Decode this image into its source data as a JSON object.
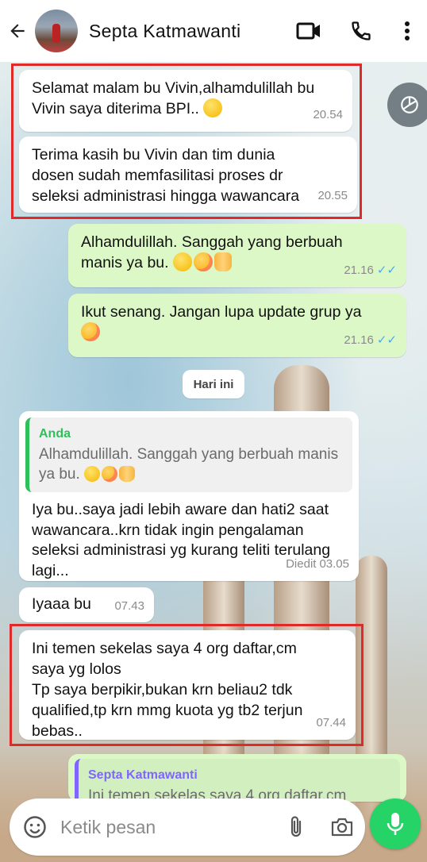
{
  "header": {
    "contact_name": "Septa Katmawanti",
    "icons": [
      "back-arrow-icon",
      "video-call-icon",
      "phone-icon",
      "more-vert-icon"
    ]
  },
  "messages": {
    "m1": {
      "text": "Selamat malam bu Vivin,alhamdulillah bu Vivin saya diterima BPI..",
      "emoji": "pleading-face",
      "time": "20.54"
    },
    "m2": {
      "text": "Terima kasih bu Vivin dan tim dunia dosen sudah memfasilitasi proses dr seleksi administrasi hingga wawancara",
      "time": "20.55"
    },
    "m3": {
      "text": "Alhamdulillah. Sanggah yang berbuah manis ya bu.",
      "emoji": [
        "star-struck",
        "smiling-hearts",
        "folded-hands"
      ],
      "time": "21.16",
      "ticks": "✓✓"
    },
    "m4": {
      "text": "Ikut senang. Jangan lupa update grup ya",
      "emoji": "smiling-hearts",
      "time": "21.16",
      "ticks": "✓✓"
    },
    "date_divider": "Hari ini",
    "m5": {
      "quote_author": "Anda",
      "quote_text": "Alhamdulillah. Sanggah yang berbuah manis ya bu.",
      "text": "Iya bu..saya jadi lebih aware dan hati2 saat wawancara..krn tidak ingin pengalaman seleksi administrasi yg kurang teliti terulang lagi...",
      "edited_label": "Diedit",
      "time": "03.05"
    },
    "m6": {
      "text": "Iyaaa bu",
      "time": "07.43"
    },
    "m7": {
      "text": "Ini temen sekelas saya 4 org daftar,cm saya yg lolos\nTp saya berpikir,bukan krn beliau2 tdk qualified,tp krn mmg kuota yg tb2 terjun bebas..",
      "time": "07.44"
    },
    "m8": {
      "quote_author": "Septa Katmawanti",
      "quote_text": "Ini temen sekelas saya 4 org daftar,cm"
    }
  },
  "composer": {
    "placeholder": "Ketik pesan",
    "icons": [
      "emoji-icon",
      "attach-icon",
      "camera-icon",
      "mic-icon"
    ]
  },
  "colors": {
    "incoming_bubble": "#ffffff",
    "outgoing_bubble": "#dcf8c6",
    "read_ticks": "#4fa8ea",
    "highlight_box": "#e02a2a",
    "mic_button": "#25d366"
  }
}
